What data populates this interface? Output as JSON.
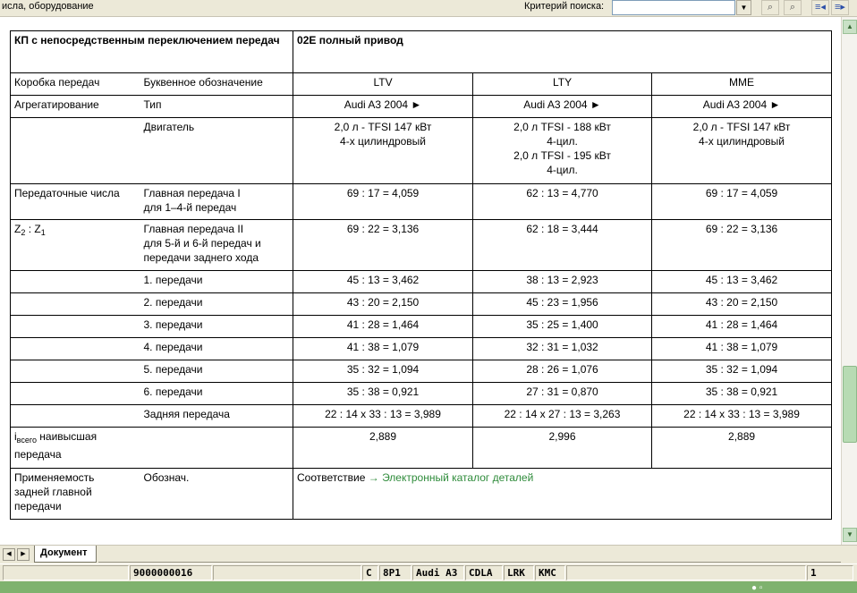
{
  "topbar": {
    "section_title": "исла, оборудование",
    "search_label": "Критерий поиска:",
    "search_value": "",
    "dropdown_icon": "chevron-down-icon"
  },
  "table": {
    "header": {
      "left": "КП с непосредственным переключением передач",
      "right": "02E полный привод"
    },
    "gearbox": {
      "label": "Коробка передач",
      "sub": "Буквенное обозначение",
      "codes": [
        "LTV",
        "LTY",
        "MME"
      ]
    },
    "aggregation": {
      "label": "Агрегатирование",
      "sub": "Тип",
      "types": [
        "Audi A3 2004 ►",
        "Audi A3 2004 ►",
        "Audi A3 2004 ►"
      ]
    },
    "engine": {
      "sub": "Двигатель",
      "values": [
        [
          "2,0 л - TFSI 147 кВт",
          "4-х цилиндровый"
        ],
        [
          "2,0 л TFSI - 188 кВт",
          "4-цил.",
          "2,0 л TFSI - 195 кВт",
          "4-цил."
        ],
        [
          "2,0 л - TFSI 147 кВт",
          "4-х цилиндровый"
        ]
      ]
    },
    "ratios": {
      "label": "Передаточные числа",
      "z_main": "Z",
      "z_sub2": "2",
      "z_sep": " : Z",
      "z_sub1": "1",
      "rows": [
        {
          "label": [
            "Главная передача I",
            "для 1–4-й передач"
          ],
          "values": [
            "69 : 17 = 4,059",
            "62 : 13 = 4,770",
            "69 : 17 = 4,059"
          ]
        },
        {
          "label": [
            "Главная передача II",
            "для 5-й и 6-й передач и",
            "передачи заднего хода"
          ],
          "values": [
            "69 : 22 = 3,136",
            "62 : 18 = 3,444",
            "69 : 22 = 3,136"
          ]
        },
        {
          "label": [
            "1. передачи"
          ],
          "values": [
            "45 : 13 = 3,462",
            "38 : 13 = 2,923",
            "45 : 13 = 3,462"
          ]
        },
        {
          "label": [
            "2. передачи"
          ],
          "values": [
            "43 : 20 = 2,150",
            "45 : 23 = 1,956",
            "43 : 20 = 2,150"
          ]
        },
        {
          "label": [
            "3. передачи"
          ],
          "values": [
            "41 : 28 = 1,464",
            "35 : 25 = 1,400",
            "41 : 28 = 1,464"
          ]
        },
        {
          "label": [
            "4. передачи"
          ],
          "values": [
            "41 : 38 = 1,079",
            "32 : 31 = 1,032",
            "41 : 38 = 1,079"
          ]
        },
        {
          "label": [
            "5. передачи"
          ],
          "values": [
            "35 : 32 = 1,094",
            "28 : 26 = 1,076",
            "35 : 32 = 1,094"
          ]
        },
        {
          "label": [
            "6. передачи"
          ],
          "values": [
            "35 : 38 = 0,921",
            "27 : 31 = 0,870",
            "35 : 38 = 0,921"
          ]
        },
        {
          "label": [
            "Задняя передача"
          ],
          "values": [
            "22 : 14 x 33 : 13 = 3,989",
            "22 : 14 x 27 : 13 = 3,263",
            "22 : 14 x 33 : 13 = 3,989"
          ]
        }
      ]
    },
    "total": {
      "i": "i",
      "sub": "всего",
      "label_rest": " наивысшая",
      "label_line2": "передача",
      "values": [
        "2,889",
        "2,996",
        "2,889"
      ]
    },
    "applicability": {
      "label": [
        "Применяемость",
        "задней главной",
        "передачи"
      ],
      "sub": "Обознач.",
      "text": "Соответствие ",
      "link": "→ Электронный каталог деталей"
    }
  },
  "tabs": {
    "prev_icon": "arrow-left-icon",
    "next_icon": "arrow-right-icon",
    "document_tab": "Документ"
  },
  "statusbar": {
    "number": "9000000016",
    "fields": [
      "C",
      "8P1",
      "Audi A3",
      "CDLA",
      "LRK",
      "KMC"
    ],
    "page": "1"
  },
  "colors": {
    "link": "#2e8b3a",
    "chrome": "#ece9d8",
    "scroll_thumb": "#b7dbb3",
    "taskbar": "#7fb26e"
  }
}
